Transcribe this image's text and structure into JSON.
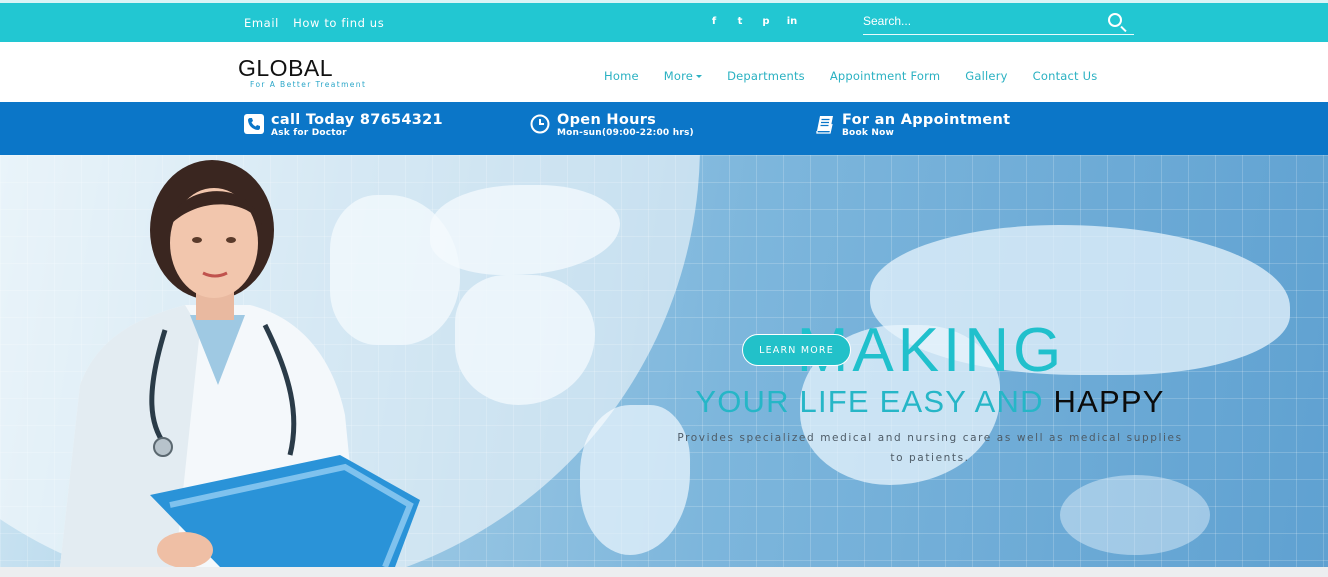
{
  "topbar": {
    "links": [
      "Email",
      "How to find us"
    ],
    "social": [
      {
        "icon": "facebook-icon",
        "glyph": "f"
      },
      {
        "icon": "twitter-icon",
        "glyph": "t"
      },
      {
        "icon": "pinterest-icon",
        "glyph": "p"
      },
      {
        "icon": "linkedin-icon",
        "glyph": "in"
      }
    ],
    "search_placeholder": "Search..."
  },
  "brand": {
    "title": "GLOBAL",
    "tagline": "For A Better Treatment"
  },
  "nav": {
    "items": [
      "Home",
      "More",
      "Departments",
      "Appointment Form",
      "Gallery",
      "Contact Us"
    ]
  },
  "info": [
    {
      "icon": "phone-icon",
      "title": "call Today 87654321",
      "subtitle": "Ask for Doctor"
    },
    {
      "icon": "clock-icon",
      "title": "Open Hours",
      "subtitle": "Mon-sun(09:00-22:00 hrs)"
    },
    {
      "icon": "book-icon",
      "title": "For an Appointment",
      "subtitle": "Book Now"
    }
  ],
  "hero": {
    "headline": "MAKING",
    "subline_part1": "YOUR LIFE EASY AND ",
    "subline_part2": "HAPPY",
    "description": "Provides specialized medical and nursing care as well as medical supplies to patients.",
    "button": "LEARN MORE"
  },
  "colors": {
    "topbar": "#22c7d2",
    "infobar": "#0b76c8",
    "accent": "#20c0cc"
  }
}
